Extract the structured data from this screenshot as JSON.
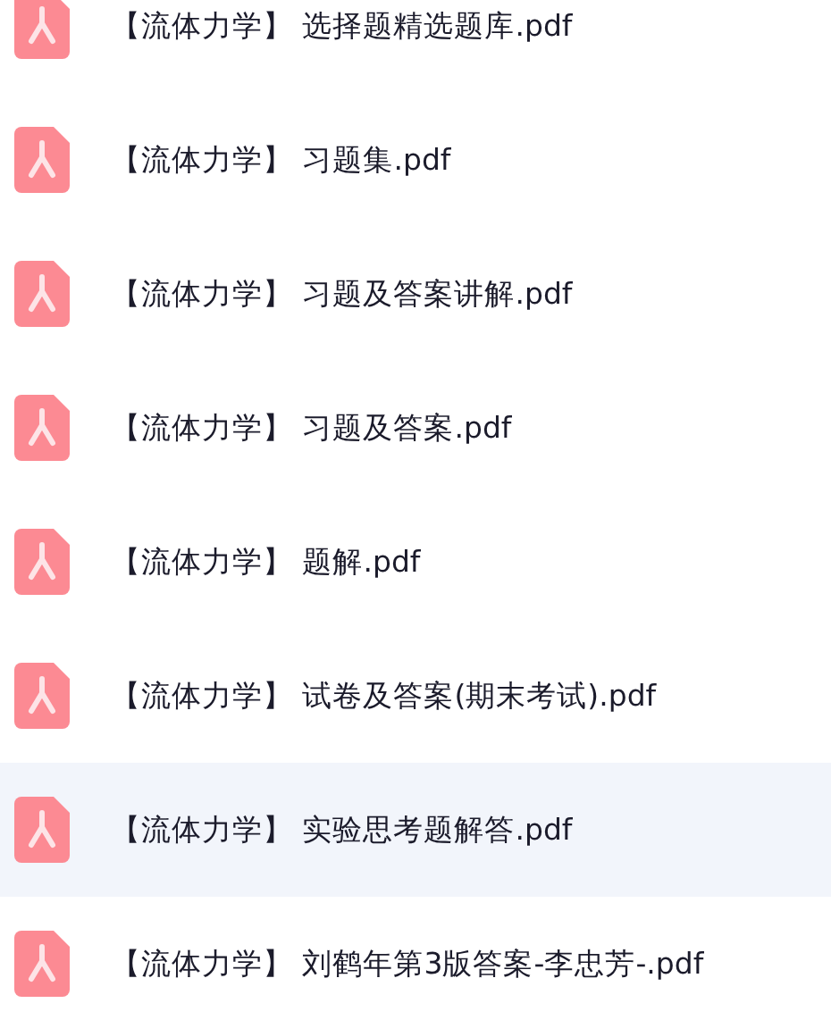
{
  "files": [
    {
      "name": "【流体力学】 选择题精选题库.pdf",
      "selected": false
    },
    {
      "name": "【流体力学】 习题集.pdf",
      "selected": false
    },
    {
      "name": "【流体力学】 习题及答案讲解.pdf",
      "selected": false
    },
    {
      "name": "【流体力学】 习题及答案.pdf",
      "selected": false
    },
    {
      "name": "【流体力学】 题解.pdf",
      "selected": false
    },
    {
      "name": "【流体力学】 试卷及答案(期末考试).pdf",
      "selected": false
    },
    {
      "name": "【流体力学】 实验思考题解答.pdf",
      "selected": true
    },
    {
      "name": "【流体力学】 刘鹤年第3版答案-李忠芳-.pdf",
      "selected": false
    }
  ]
}
